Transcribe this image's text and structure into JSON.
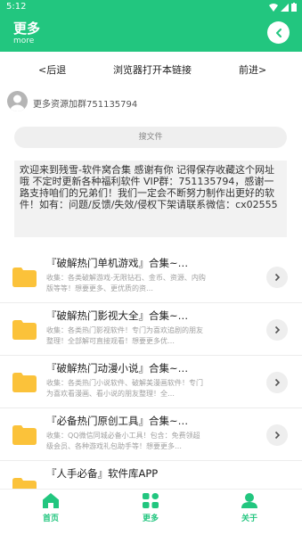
{
  "status_bar": {
    "time": "5:12"
  },
  "header": {
    "title": "更多",
    "subtitle": "more",
    "back_icon": "chevron-left-icon"
  },
  "nav": {
    "back": "<后退",
    "open_browser": "浏览器打开本链接",
    "forward": "前进>"
  },
  "qq_group": {
    "text": "更多资源加群751135794"
  },
  "search": {
    "placeholder": "搜文件"
  },
  "notice": {
    "text": "欢迎来到残雪-软件窝合集 感谢有你 记得保存收藏这个网址哦 不定时更新各种福利软件 VIP群：751135794，感谢一路支持咱们的兄弟们！我们一定会不断努力制作出更好的软件！如有：问题/反馈/失效/侵权下架请联系微信：cx02555"
  },
  "items": [
    {
      "title": "『破解热门单机游戏』合集~…",
      "desc": "收集：各类破解游戏-无限钻石、金币、资源、内购版等等！想要更多、更优质的资…"
    },
    {
      "title": "『破解热门影视大全』合集~…",
      "desc": "收集：各类热门影视软件！专门为喜欢追剧的朋友整理！全部解可直接观看！想要更多优…"
    },
    {
      "title": "『破解热门动漫小说』合集~…",
      "desc": "收集：各类热门小说软件、破解美漫画软件！专门为喜欢看漫画、看小说的朋友整理！全…"
    },
    {
      "title": "『必备热门原创工具』合集~…",
      "desc": "收集：QQ微信同城必备小工具！包含：免费领超级会员、各种游戏礼包助手等！想要更多…"
    },
    {
      "title": "『人手必备』软件库APP",
      "desc": ""
    }
  ],
  "tabs": [
    {
      "label": "首页",
      "icon": "home-icon"
    },
    {
      "label": "更多",
      "icon": "grid-icon"
    },
    {
      "label": "关于",
      "icon": "user-icon"
    }
  ],
  "colors": {
    "accent": "#22c67f",
    "folder": "#fbc23a"
  }
}
